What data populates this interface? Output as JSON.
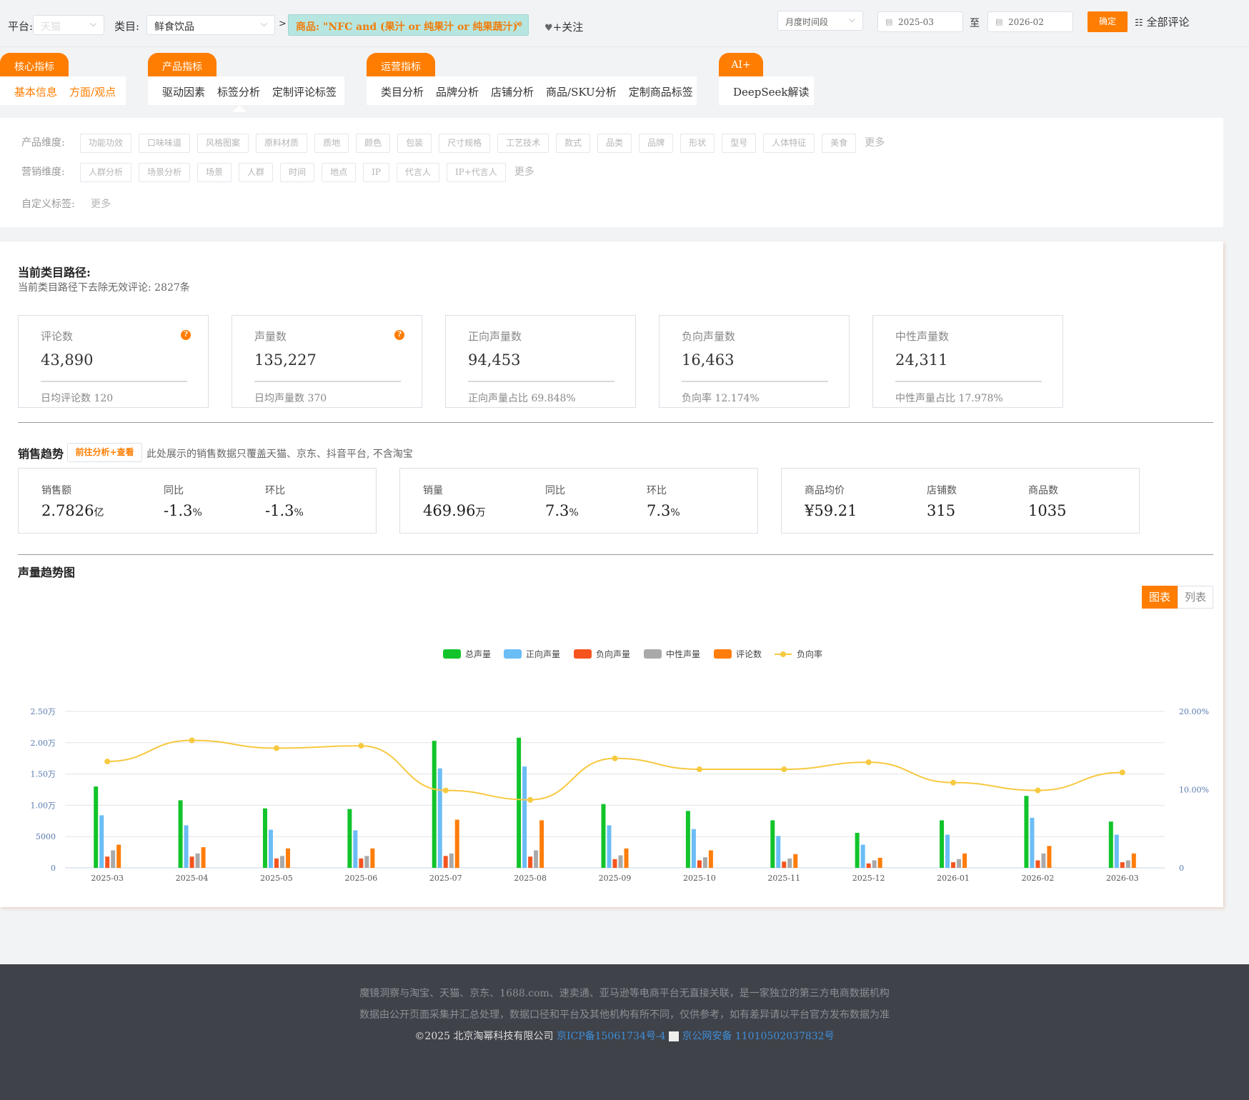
{
  "filters": {
    "platform_label": "平台:",
    "platform_value": "天猫",
    "category_label": "类目:",
    "category_value": "鲜食饮品",
    "breadcrumb_sep": ">",
    "product_chip": "商品: \"NFC and (果汁 or 纯果汁 or 纯果蔬汁)\"",
    "chip_close": "×",
    "follow_label": "+关注",
    "period_select": "月度时间段",
    "date_from": "2025-03",
    "date_to_sep": "至",
    "date_to": "2026-02",
    "confirm": "确定",
    "all_comments": "全部评论"
  },
  "nav_groups": [
    {
      "tab": "核心指标",
      "items": [
        "基本信息",
        "方面/观点"
      ]
    },
    {
      "tab": "产品指标",
      "items": [
        "驱动因素",
        "标签分析",
        "定制评论标签"
      ]
    },
    {
      "tab": "运营指标",
      "items": [
        "类目分析",
        "品牌分析",
        "店铺分析",
        "商品/SKU分析",
        "定制商品标签"
      ]
    },
    {
      "tab": "AI+",
      "items": [
        "DeepSeek解读"
      ]
    }
  ],
  "dimensions": {
    "product_label": "产品维度:",
    "product_tags": [
      "功能功效",
      "口味味道",
      "风格图案",
      "原料材质",
      "质地",
      "颜色",
      "包装",
      "尺寸规格",
      "工艺技术",
      "款式",
      "品类",
      "品牌",
      "形状",
      "型号",
      "人体特征",
      "美食"
    ],
    "marketing_label": "营销维度:",
    "marketing_tags": [
      "人群分析",
      "场景分析",
      "场景",
      "人群",
      "时间",
      "地点",
      "IP",
      "代言人",
      "IP+代言人"
    ],
    "custom_label": "自定义标签:",
    "more": "更多"
  },
  "path": {
    "title": "当前类目路径:",
    "subtitle": "当前类目路径下去除无效评论: 2827条"
  },
  "kpis": [
    {
      "title": "评论数",
      "value": "43,890",
      "footer": "日均评论数   120",
      "help": true
    },
    {
      "title": "声量数",
      "value": "135,227",
      "footer": "日均声量数   370",
      "help": true
    },
    {
      "title": "正向声量数",
      "value": "94,453",
      "footer": "正向声量占比   69.848%",
      "help": false
    },
    {
      "title": "负向声量数",
      "value": "16,463",
      "footer": "负向率   12.174%",
      "help": false
    },
    {
      "title": "中性声量数",
      "value": "24,311",
      "footer": "中性声量占比   17.978%",
      "help": false
    }
  ],
  "sales": {
    "title": "销售趋势",
    "link": "前往分析+查看",
    "note": "此处展示的销售数据只覆盖天猫、京东、抖音平台, 不含淘宝",
    "cards": [
      [
        {
          "k": "销售额",
          "n": "2.7826",
          "u": "亿"
        },
        {
          "k": "同比",
          "n": "-1.3",
          "u": "%"
        },
        {
          "k": "环比",
          "n": "-1.3",
          "u": "%"
        }
      ],
      [
        {
          "k": "销量",
          "n": "469.96",
          "u": "万"
        },
        {
          "k": "同比",
          "n": "7.3",
          "u": "%"
        },
        {
          "k": "环比",
          "n": "7.3",
          "u": "%"
        }
      ],
      [
        {
          "k": "商品均价",
          "n": "¥59.21",
          "u": ""
        },
        {
          "k": "店铺数",
          "n": "315",
          "u": ""
        },
        {
          "k": "商品数",
          "n": "1035",
          "u": ""
        }
      ]
    ]
  },
  "trend": {
    "title": "声量趋势图",
    "toggle_chart": "图表",
    "toggle_list": "列表"
  },
  "chart_data": {
    "type": "bar",
    "categories": [
      "2025-03",
      "2025-04",
      "2025-05",
      "2025-06",
      "2025-07",
      "2025-08",
      "2025-09",
      "2025-10",
      "2025-11",
      "2025-12",
      "2026-01",
      "2026-02",
      "2026-03"
    ],
    "series": [
      {
        "name": "总声量",
        "color": "#12c42a",
        "values": [
          13000,
          10800,
          9500,
          9400,
          20300,
          20800,
          10200,
          9100,
          7600,
          5600,
          7600,
          11500,
          7400
        ]
      },
      {
        "name": "正向声量",
        "color": "#6bbdf5",
        "values": [
          8400,
          6800,
          6100,
          6000,
          15900,
          16200,
          6800,
          6200,
          5100,
          3700,
          5300,
          8000,
          5300
        ]
      },
      {
        "name": "负向声量",
        "color": "#f5541f",
        "values": [
          1800,
          1800,
          1500,
          1500,
          1900,
          1800,
          1400,
          1200,
          1000,
          700,
          900,
          1200,
          900
        ]
      },
      {
        "name": "中性声量",
        "color": "#a9a9a9",
        "values": [
          2800,
          2300,
          1900,
          1900,
          2300,
          2800,
          2000,
          1700,
          1500,
          1200,
          1400,
          2300,
          1200
        ]
      },
      {
        "name": "评论数",
        "color": "#ff7d0a",
        "values": [
          3700,
          3300,
          3100,
          3100,
          7700,
          7600,
          3100,
          2800,
          2200,
          1600,
          2300,
          3500,
          2300
        ]
      },
      {
        "name": "负向率",
        "color": "#f7c940",
        "type": "line",
        "axis": "right",
        "values": [
          13.6,
          16.3,
          15.3,
          15.6,
          9.9,
          8.7,
          14.0,
          12.6,
          12.6,
          13.5,
          10.9,
          9.9,
          12.2
        ]
      }
    ],
    "left_ticks": [
      "0",
      "5000",
      "1.00万",
      "1.50万",
      "2.00万",
      "2.50万"
    ],
    "right_ticks": [
      "0",
      "10.00%",
      "20.00%"
    ],
    "ylim": [
      0,
      25000
    ],
    "y2lim": [
      0,
      20
    ],
    "grid": true,
    "legend_position": "top-center"
  }
}
